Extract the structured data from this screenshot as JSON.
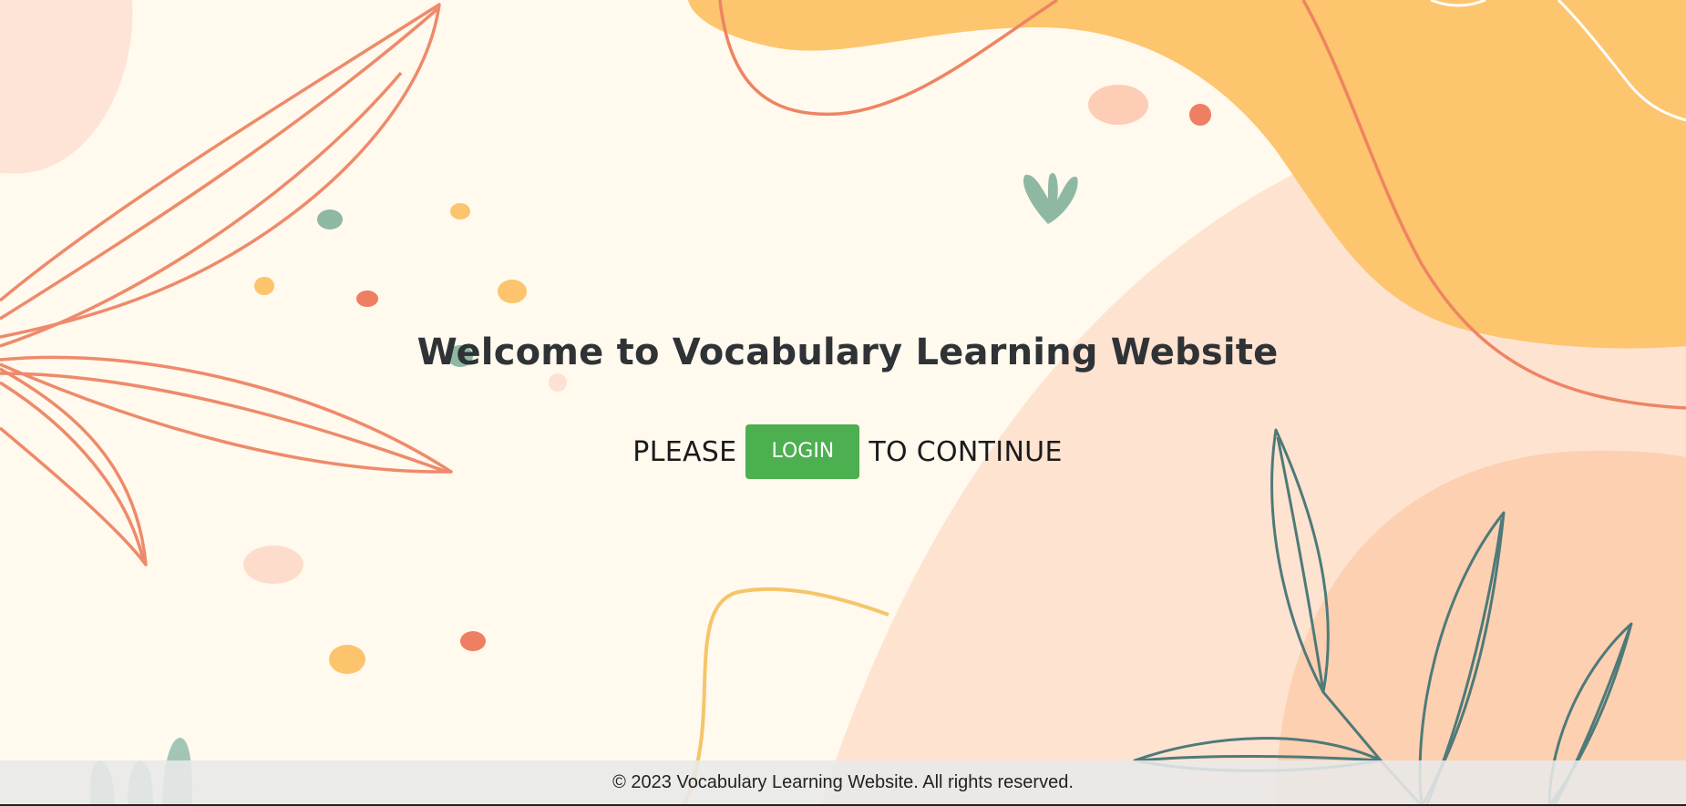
{
  "main": {
    "title": "Welcome to Vocabulary Learning Website",
    "prompt_before": "PLEASE",
    "login_label": "LOGIN",
    "prompt_after": "TO CONTINUE"
  },
  "footer": {
    "copyright": "© 2023 Vocabulary Learning Website. All rights reserved."
  },
  "colors": {
    "background": "#fff9ee",
    "accent_orange": "#fcc46c",
    "peach": "#fee2d0",
    "coral_line": "#ee8a6a",
    "teal_line": "#4e7a78",
    "login_button": "#4caf50"
  },
  "decorations": {
    "left": "coral-leaf-outline",
    "top-right": "orange-blob",
    "bottom-right": "teal-leaf-outline",
    "scattered": "colored-dots"
  }
}
